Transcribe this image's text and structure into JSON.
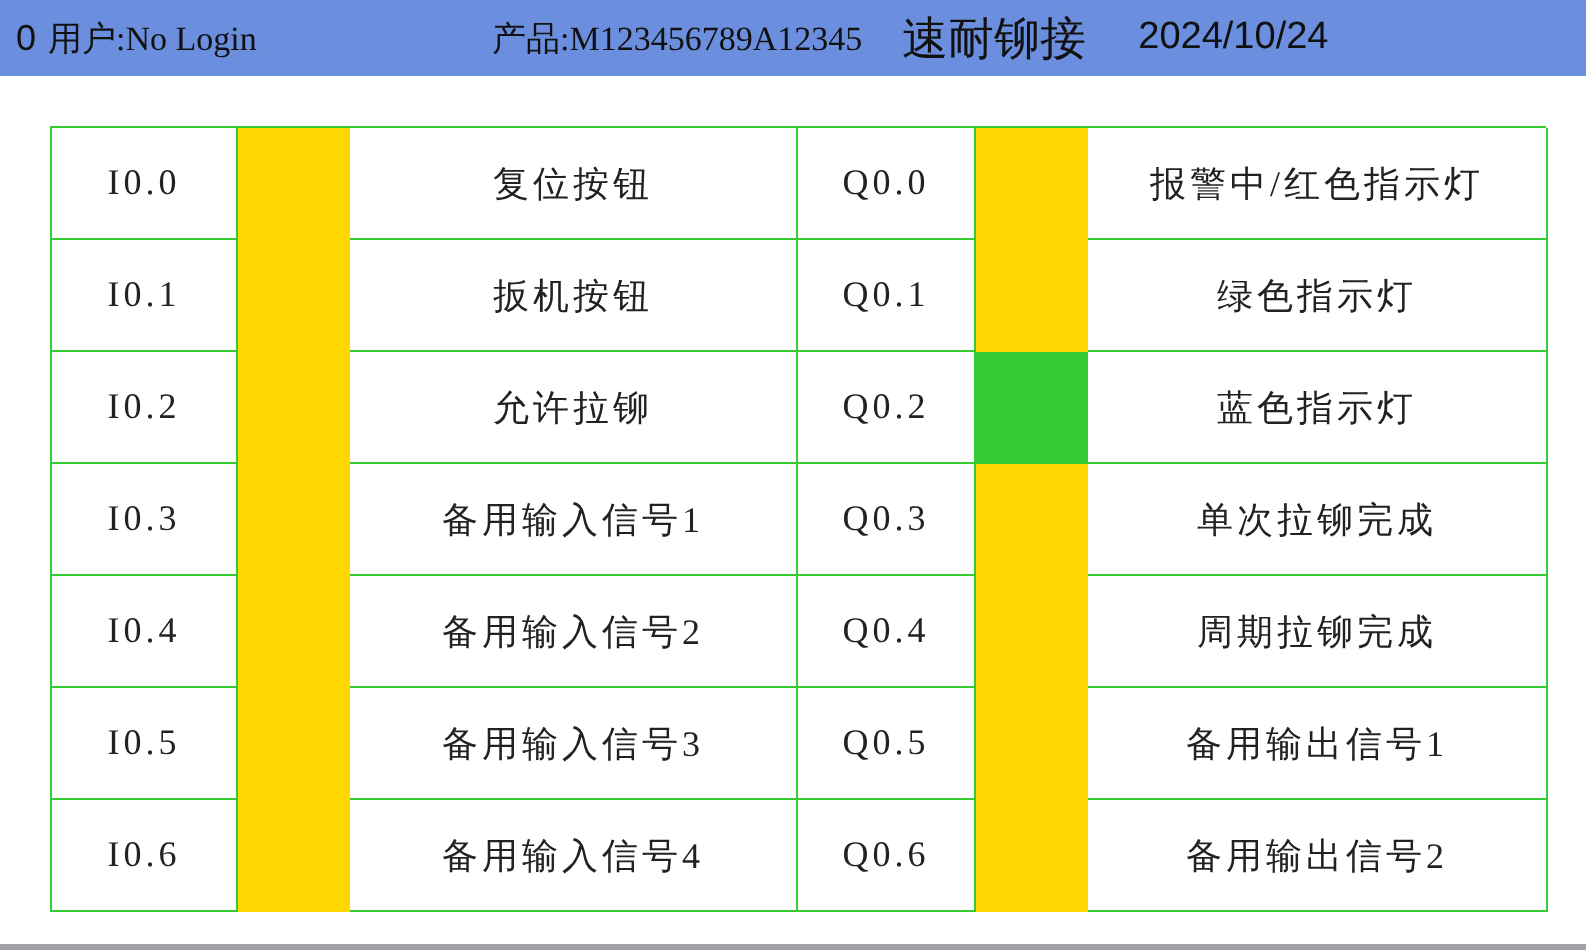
{
  "header": {
    "user_id": "0",
    "user": "用户:No Login",
    "product": "产品:M123456789A12345",
    "title": "速耐铆接",
    "date": "2024/10/24"
  },
  "inputs": [
    {
      "address": "I0.0",
      "on": false,
      "label": "复位按钮"
    },
    {
      "address": "I0.1",
      "on": false,
      "label": "扳机按钮"
    },
    {
      "address": "I0.2",
      "on": false,
      "label": "允许拉铆"
    },
    {
      "address": "I0.3",
      "on": false,
      "label": "备用输入信号1"
    },
    {
      "address": "I0.4",
      "on": false,
      "label": "备用输入信号2"
    },
    {
      "address": "I0.5",
      "on": false,
      "label": "备用输入信号3"
    },
    {
      "address": "I0.6",
      "on": false,
      "label": "备用输入信号4"
    }
  ],
  "outputs": [
    {
      "address": "Q0.0",
      "on": false,
      "label": "报警中/红色指示灯"
    },
    {
      "address": "Q0.1",
      "on": false,
      "label": "绿色指示灯"
    },
    {
      "address": "Q0.2",
      "on": true,
      "label": "蓝色指示灯"
    },
    {
      "address": "Q0.3",
      "on": false,
      "label": "单次拉铆完成"
    },
    {
      "address": "Q0.4",
      "on": false,
      "label": "周期拉铆完成"
    },
    {
      "address": "Q0.5",
      "on": false,
      "label": "备用输出信号1"
    },
    {
      "address": "Q0.6",
      "on": false,
      "label": "备用输出信号2"
    }
  ]
}
